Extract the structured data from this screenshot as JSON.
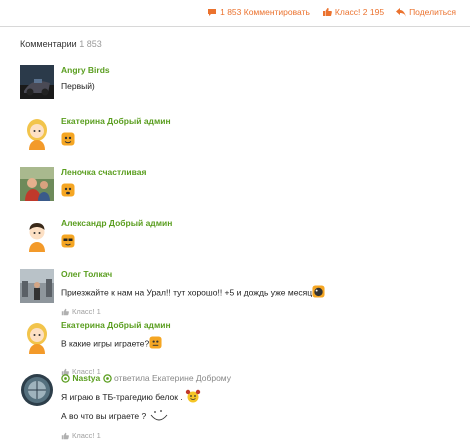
{
  "toolbar": {
    "comments_label": "1 853 Комментировать",
    "like_label": "Класс! 2 195",
    "share_label": "Поделиться"
  },
  "section": {
    "title": "Комментарии",
    "count": "1 853"
  },
  "comments": [
    {
      "author": "Angry Birds",
      "text": "Первый)"
    },
    {
      "author": "Екатерина Добрый админ"
    },
    {
      "author": "Леночка счастливая"
    },
    {
      "author": "Александр Добрый админ"
    },
    {
      "author": "Олег Толкач",
      "text": "Приезжайте к нам на Урал!! тут хорошо!! +5 и дождь уже месяц"
    },
    {
      "author": "Екатерина Добрый админ",
      "text": "В какие игры играете?",
      "likes": "Класс! 1"
    },
    {
      "author": "Nastya",
      "reply_to": "ответила Екатерине Доброму",
      "text": "Я играю в ТБ-трагедию белок .",
      "text2": "А во что вы играете ?",
      "likes": "Класс! 1"
    }
  ],
  "first_likes": "Класс! 1",
  "colors": {
    "accent": "#eb722e",
    "author": "#5a9e1f"
  },
  "icons": [
    "comment-icon",
    "like-icon",
    "share-icon",
    "thumb-up-icon",
    "smiley-icon"
  ]
}
